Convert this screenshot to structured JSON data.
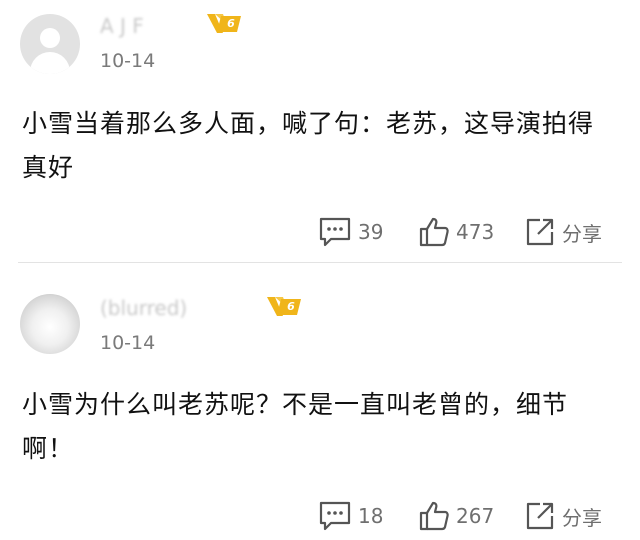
{
  "comments": [
    {
      "username": "A  J F",
      "vip_level": "6",
      "date": "10-14",
      "text": "小雪当着那么多人面，喊了句：老苏，这导演拍得真好",
      "reply_count": "39",
      "like_count": "473",
      "share_label": "分享"
    },
    {
      "username": "(blurred)",
      "vip_level": "6",
      "date": "10-14",
      "text": "小雪为什么叫老苏呢？不是一直叫老曾的，细节啊！",
      "reply_count": "18",
      "like_count": "267",
      "share_label": "分享"
    }
  ],
  "icons": {
    "reply": "comment-bubble-icon",
    "like": "thumbs-up-icon",
    "share": "share-arrow-icon",
    "vip": "vip-crown-badge"
  },
  "colors": {
    "vip_gold": "#f0b51a",
    "icon_gray": "#555555",
    "count_gray": "#6f6f6f",
    "date_gray": "#7a7a7a"
  }
}
